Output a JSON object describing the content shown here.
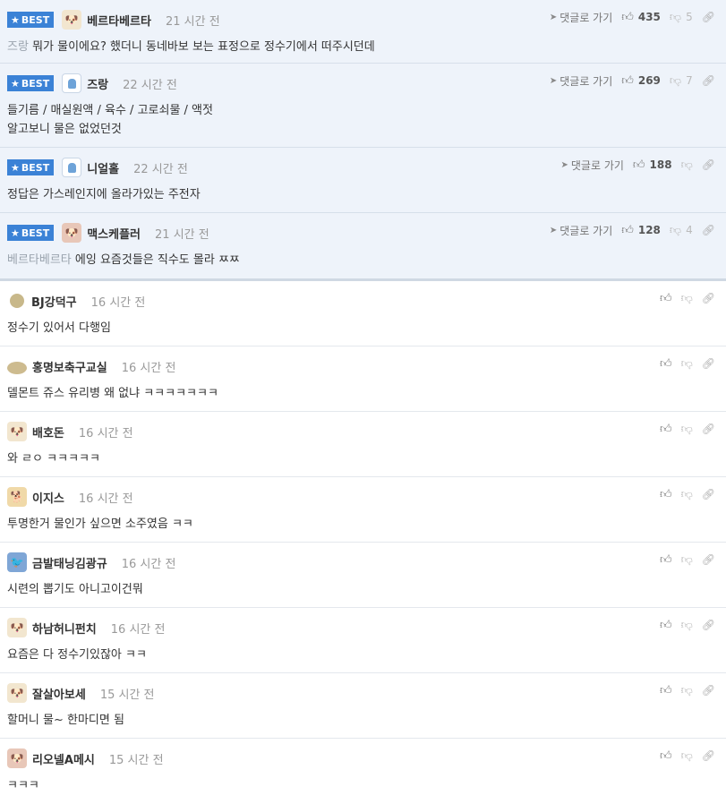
{
  "reply_label": "댓글로 가기",
  "best_label": "BEST",
  "icons": {
    "thumbs_up": "thumbs-up-icon",
    "thumbs_down": "thumbs-down-icon",
    "link": "link-icon",
    "reply_arrow": "send-arrow-icon",
    "best_star": "star-icon"
  },
  "colors": {
    "best_badge": "#3b82d6",
    "best_row_bg": "#eef3fa",
    "mention": "#9aa3ad",
    "time": "#999999"
  },
  "best_comments": [
    {
      "name": "베르타베르타",
      "time": "21 시간 전",
      "up": "435",
      "down": "5",
      "mention": "즈랑",
      "lines": [
        "뭐가 물이에요? 했더니 동네바보 보는 표정으로 정수기에서 떠주시던데"
      ]
    },
    {
      "name": "즈랑",
      "time": "22 시간 전",
      "up": "269",
      "down": "7",
      "mention": "",
      "lines": [
        "들기름 / 매실원액 / 육수 / 고로쇠물 / 액젓",
        "알고보니 물은 없었던것"
      ]
    },
    {
      "name": "니얼홀",
      "time": "22 시간 전",
      "up": "188",
      "down": "",
      "mention": "",
      "lines": [
        "정답은 가스레인지에 올라가있는 주전자"
      ]
    },
    {
      "name": "맥스케플러",
      "time": "21 시간 전",
      "up": "128",
      "down": "4",
      "mention": "베르타베르타",
      "lines": [
        "에잉 요즘것들은 직수도 몰라 ㅉㅉ"
      ]
    }
  ],
  "comments": [
    {
      "name": "BJ강덕구",
      "time": "16 시간 전",
      "text": "정수기 있어서 다행임"
    },
    {
      "name": "홍명보축구교실",
      "time": "16 시간 전",
      "text": "델몬트 쥬스 유리병 왜 없냐 ㅋㅋㅋㅋㅋㅋㅋ"
    },
    {
      "name": "배호돈",
      "time": "16 시간 전",
      "text": "와 ㄹㅇ ㅋㅋㅋㅋㅋ"
    },
    {
      "name": "이지스",
      "time": "16 시간 전",
      "text": "투명한거 물인가 싶으면 소주였음 ㅋㅋ"
    },
    {
      "name": "금발태닝김광규",
      "time": "16 시간 전",
      "text": "시련의 뽑기도 아니고이건뭐"
    },
    {
      "name": "하남허니펀치",
      "time": "16 시간 전",
      "text": "요즘은 다 정수기있잖아 ㅋㅋ"
    },
    {
      "name": "잘살아보세",
      "time": "15 시간 전",
      "text": "할머니 물~ 한마디면 됨"
    },
    {
      "name": "리오넬A메시",
      "time": "15 시간 전",
      "text": "ㅋㅋㅋ"
    }
  ]
}
